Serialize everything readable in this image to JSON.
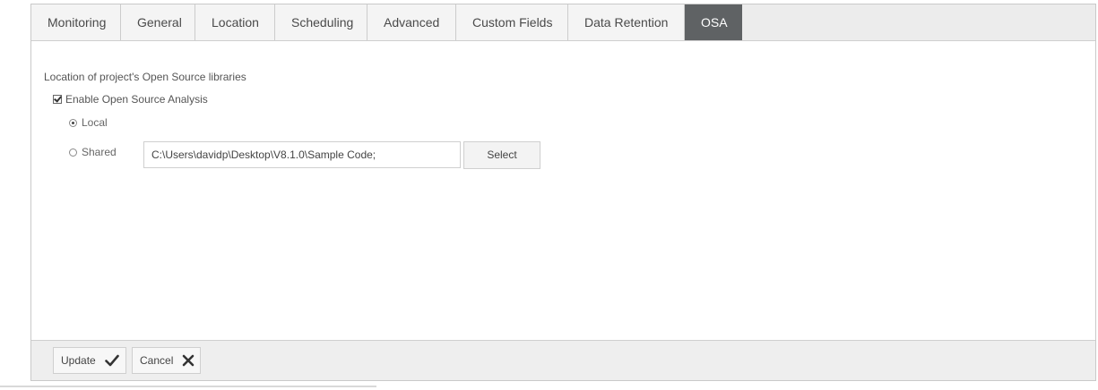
{
  "tabs": [
    {
      "label": "Monitoring"
    },
    {
      "label": "General"
    },
    {
      "label": "Location"
    },
    {
      "label": "Scheduling"
    },
    {
      "label": "Advanced"
    },
    {
      "label": "Custom Fields"
    },
    {
      "label": "Data Retention"
    },
    {
      "label": "OSA",
      "active": true
    }
  ],
  "osa": {
    "section_label": "Location of project's Open Source libraries",
    "enable_label": "Enable Open Source Analysis",
    "enable_checked": true,
    "local_label": "Local",
    "shared_label": "Shared",
    "selected_location": "Local",
    "path_value": "C:\\Users\\davidp\\Desktop\\V8.1.0\\Sample Code;",
    "select_label": "Select"
  },
  "footer": {
    "update_label": "Update",
    "cancel_label": "Cancel",
    "update_icon": "checkmark-icon",
    "cancel_icon": "close-icon"
  },
  "colors": {
    "active_tab_bg": "#5f6264",
    "tab_bg": "#f4f4f4",
    "footer_bg": "#eeeeee"
  }
}
